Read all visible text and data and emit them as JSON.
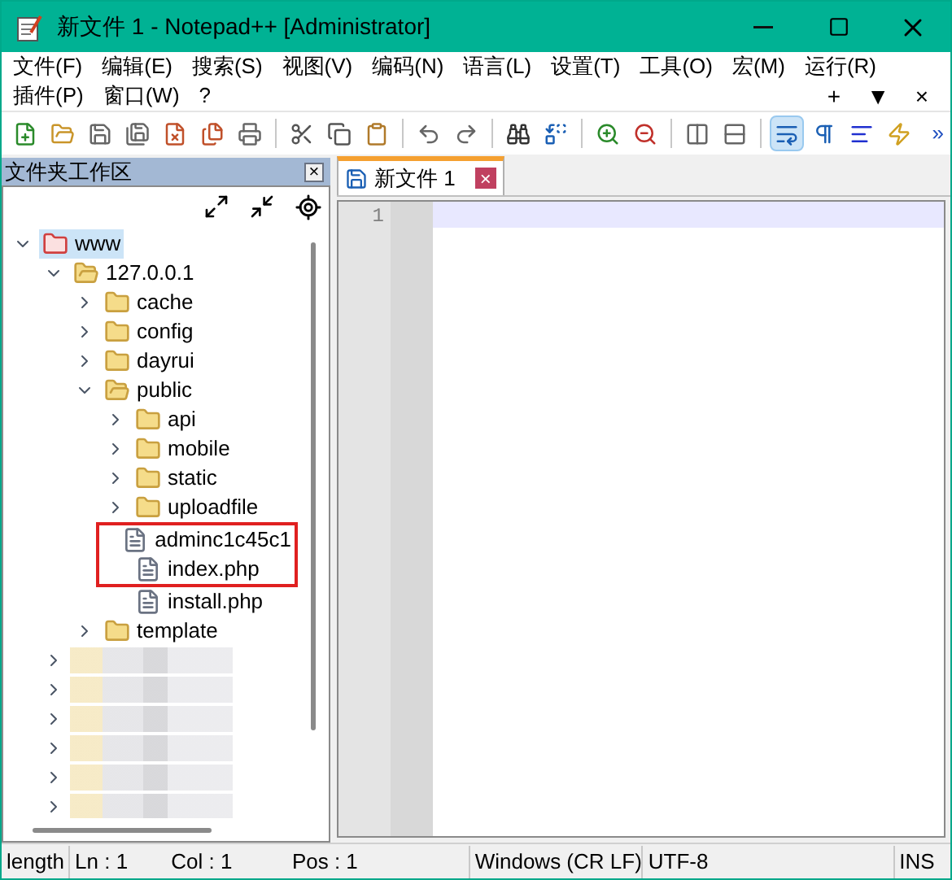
{
  "window": {
    "title": "新文件 1 - Notepad++ [Administrator]"
  },
  "menu": {
    "rows": [
      [
        "文件(F)",
        "编辑(E)",
        "搜索(S)",
        "视图(V)",
        "编码(N)",
        "语言(L)",
        "设置(T)",
        "工具(O)",
        "宏(M)",
        "运行(R)"
      ],
      [
        "插件(P)",
        "窗口(W)",
        "?"
      ]
    ],
    "right_controls": [
      "+",
      "▼",
      "×"
    ]
  },
  "toolbar": {
    "buttons": [
      {
        "selected": false
      },
      {
        "selected": false
      },
      {
        "selected": false
      },
      {
        "selected": false
      },
      {
        "selected": false
      },
      {
        "selected": false
      },
      {
        "selected": false
      },
      {
        "selected": false
      },
      {
        "selected": false
      },
      {
        "selected": false
      },
      {
        "selected": false
      },
      {
        "selected": false
      },
      {
        "selected": false
      },
      {
        "selected": false
      },
      {
        "selected": false
      },
      {
        "selected": false
      },
      {
        "selected": false
      },
      {
        "selected": false
      },
      {
        "selected": true
      },
      {
        "selected": false
      },
      {
        "selected": false
      },
      {
        "selected": false
      }
    ],
    "overflow": "»"
  },
  "folder_panel": {
    "title": "文件夹工作区",
    "close": "×",
    "tree": [
      {
        "label": "www",
        "kind": "root",
        "expanded": true,
        "selected": true,
        "children": [
          {
            "label": "127.0.0.1",
            "kind": "folder-open",
            "expanded": true,
            "selected": false,
            "children": [
              {
                "label": "cache",
                "kind": "folder",
                "expanded": false,
                "selected": false
              },
              {
                "label": "config",
                "kind": "folder",
                "expanded": false,
                "selected": false
              },
              {
                "label": "dayrui",
                "kind": "folder",
                "expanded": false,
                "selected": false
              },
              {
                "label": "public",
                "kind": "folder-open",
                "expanded": true,
                "selected": false,
                "children": [
                  {
                    "label": "api",
                    "kind": "folder",
                    "expanded": false,
                    "selected": false
                  },
                  {
                    "label": "mobile",
                    "kind": "folder",
                    "expanded": false,
                    "selected": false
                  },
                  {
                    "label": "static",
                    "kind": "folder",
                    "expanded": false,
                    "selected": false
                  },
                  {
                    "label": "uploadfile",
                    "kind": "folder",
                    "expanded": false,
                    "selected": false
                  },
                  {
                    "label": "adminc1c45c1",
                    "kind": "file",
                    "selected": false,
                    "highlighted": true
                  },
                  {
                    "label": "index.php",
                    "kind": "file",
                    "selected": false,
                    "highlighted": true
                  },
                  {
                    "label": "install.php",
                    "kind": "file",
                    "selected": false,
                    "highlighted": false
                  }
                ]
              },
              {
                "label": "template",
                "kind": "folder",
                "expanded": false,
                "selected": false
              }
            ]
          },
          {
            "kind": "blurred",
            "expanded": false
          },
          {
            "kind": "blurred",
            "expanded": false
          },
          {
            "kind": "blurred",
            "expanded": false
          },
          {
            "kind": "blurred",
            "expanded": false
          },
          {
            "kind": "blurred",
            "expanded": false
          },
          {
            "kind": "blurred",
            "expanded": false
          }
        ]
      }
    ]
  },
  "tabs": [
    {
      "label": "新文件 1",
      "selected": true,
      "close": "×"
    }
  ],
  "editor": {
    "line_numbers": [
      "1"
    ]
  },
  "status_bar": [
    "length",
    "Ln : 1",
    "Col : 1",
    "Pos : 1",
    "Windows (CR LF)",
    "UTF-8",
    "INS"
  ]
}
